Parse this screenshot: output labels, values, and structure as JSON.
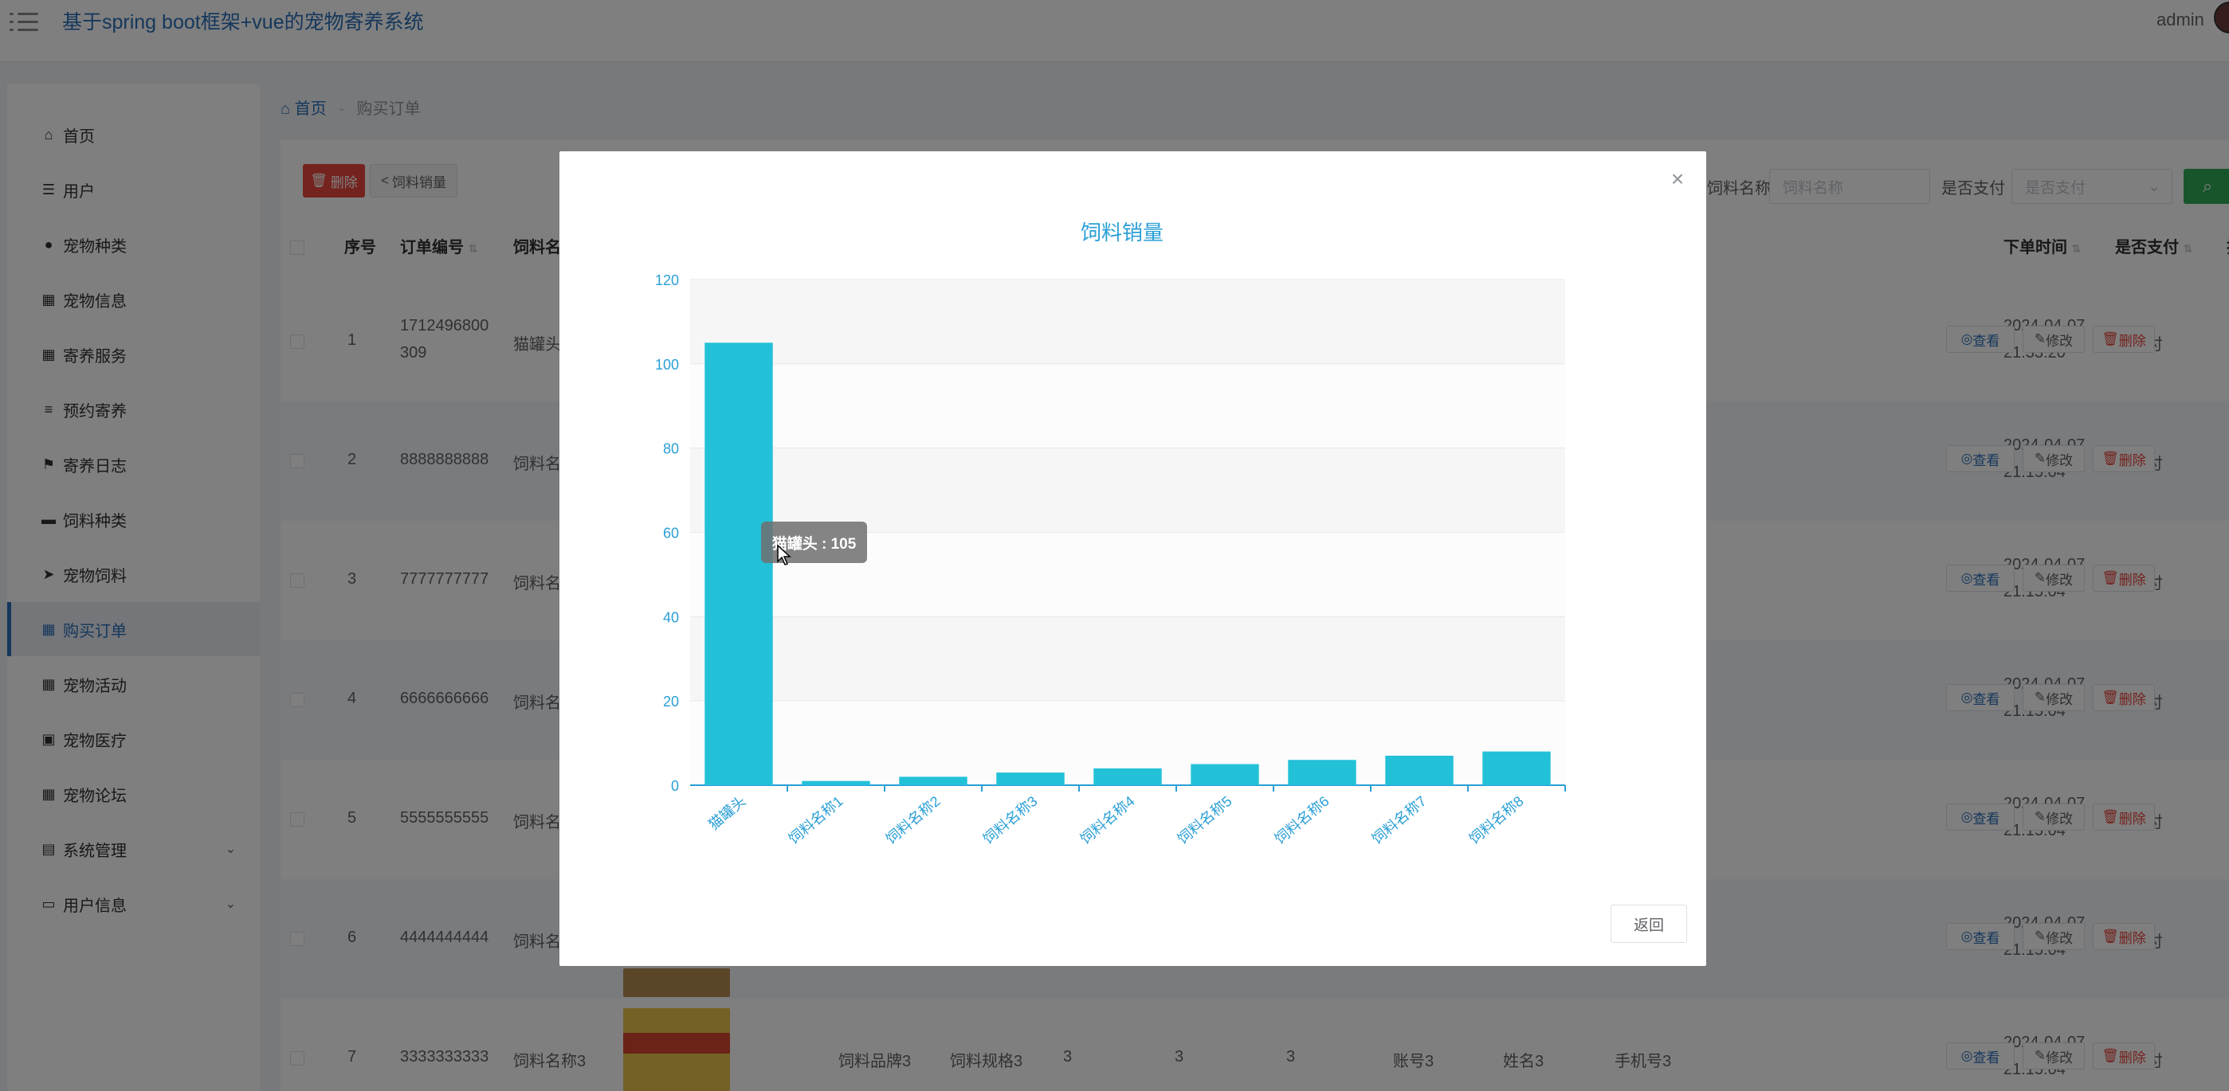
{
  "header": {
    "app_title": "基于spring boot框架+vue的宠物寄养系统",
    "user": "admin"
  },
  "sidebar": {
    "items": [
      {
        "label": "首页",
        "icon": "home-icon"
      },
      {
        "label": "用户",
        "icon": "sliders-icon"
      },
      {
        "label": "宠物种类",
        "icon": "user-icon"
      },
      {
        "label": "宠物信息",
        "icon": "grid-icon"
      },
      {
        "label": "寄养服务",
        "icon": "grid-icon"
      },
      {
        "label": "预约寄养",
        "icon": "list-icon"
      },
      {
        "label": "寄养日志",
        "icon": "flag-icon"
      },
      {
        "label": "饲料种类",
        "icon": "ticket-icon"
      },
      {
        "label": "宠物饲料",
        "icon": "send-icon"
      },
      {
        "label": "购买订单",
        "icon": "grid-icon",
        "active": true
      },
      {
        "label": "宠物活动",
        "icon": "grid-icon"
      },
      {
        "label": "宠物医疗",
        "icon": "chart-icon"
      },
      {
        "label": "宠物论坛",
        "icon": "grid-icon"
      },
      {
        "label": "系统管理",
        "icon": "lock-icon",
        "expandable": true
      },
      {
        "label": "用户信息",
        "icon": "card-icon",
        "expandable": true
      }
    ]
  },
  "breadcrumb": {
    "home": "首页",
    "separator": "-",
    "current": "购买订单"
  },
  "toolbar": {
    "delete_label": "删除",
    "sales_label": "饲料销量",
    "search_name_label": "饲料名称",
    "search_name_placeholder": "饲料名称",
    "search_paid_label": "是否支付",
    "search_paid_placeholder": "是否支付"
  },
  "table": {
    "columns": {
      "index": "序号",
      "order_no": "订单编号",
      "feed_name": "饲料名",
      "order_time": "下单时间",
      "is_paid": "是否支付",
      "actions": "操作"
    },
    "rows": [
      {
        "index": "1",
        "order_no_1": "1712496800",
        "order_no_2": "309",
        "feed_name": "猫罐头",
        "time_1": "2024-04-07",
        "time_2": "21:33:20",
        "paid": "已支付"
      },
      {
        "index": "2",
        "order_no_1": "8888888888",
        "order_no_2": "",
        "feed_name": "饲料名",
        "time_1": "2024-04-07",
        "time_2": "21:15:04",
        "paid": "未支付"
      },
      {
        "index": "3",
        "order_no_1": "7777777777",
        "order_no_2": "",
        "feed_name": "饲料名",
        "time_1": "2024-04-07",
        "time_2": "21:15:04",
        "paid": "未支付"
      },
      {
        "index": "4",
        "order_no_1": "6666666666",
        "order_no_2": "",
        "feed_name": "饲料名",
        "time_1": "2024-04-07",
        "time_2": "21:15:04",
        "paid": "未支付"
      },
      {
        "index": "5",
        "order_no_1": "5555555555",
        "order_no_2": "",
        "feed_name": "饲料名",
        "time_1": "2024-04-07",
        "time_2": "21:15:04",
        "paid": "未支付"
      },
      {
        "index": "6",
        "order_no_1": "4444444444",
        "order_no_2": "",
        "feed_name": "饲料名",
        "time_1": "2024-04-07",
        "time_2": "21:15:04",
        "paid": "未支付"
      },
      {
        "index": "7",
        "order_no_1": "3333333333",
        "order_no_2": "",
        "feed_name": "饲料名称3",
        "time_1": "2024-04-07",
        "time_2": "21:15:04",
        "paid": "未支付",
        "brand": "饲料品牌3",
        "spec": "饲料规格3",
        "c1": "3",
        "c2": "3",
        "c3": "3",
        "account": "账号3",
        "name": "姓名3",
        "phone": "手机号3"
      }
    ],
    "action_labels": {
      "view": "查看",
      "edit": "修改",
      "delete": "删除"
    }
  },
  "dialog": {
    "return_label": "返回",
    "tooltip": "猫罐头 : 105"
  },
  "colors": {
    "accent": "#2a6fb8",
    "bar": "#22c1d8",
    "danger": "#e8463c",
    "success": "#2eaa55"
  },
  "chart_data": {
    "type": "bar",
    "title": "饲料销量",
    "categories": [
      "猫罐头",
      "饲料名称1",
      "饲料名称2",
      "饲料名称3",
      "饲料名称4",
      "饲料名称5",
      "饲料名称6",
      "饲料名称7",
      "饲料名称8"
    ],
    "values": [
      105,
      1,
      2,
      3,
      4,
      5,
      6,
      7,
      8
    ],
    "yticks": [
      0,
      20,
      40,
      60,
      80,
      100,
      120
    ],
    "ylim": [
      0,
      120
    ],
    "xlabel": "",
    "ylabel": "",
    "grid": true
  }
}
